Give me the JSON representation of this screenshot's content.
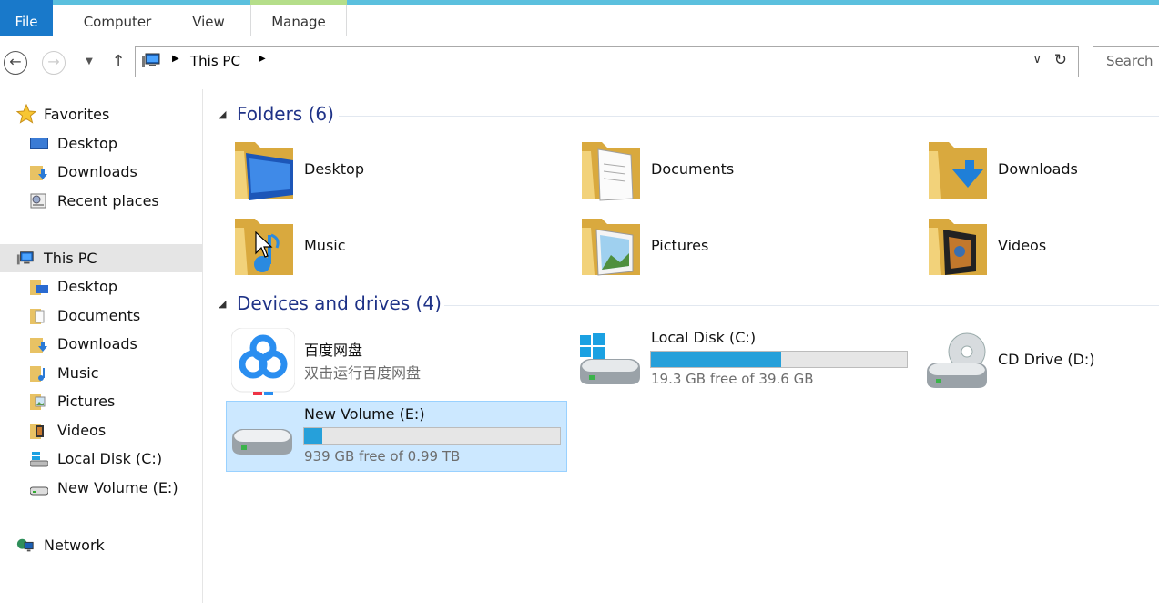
{
  "ribbon": {
    "tabs": {
      "file": "File",
      "computer": "Computer",
      "view": "View",
      "manage": "Manage"
    }
  },
  "address_bar": {
    "path": "This PC",
    "search_placeholder": "Search"
  },
  "nav_pane": {
    "favorites": "Favorites",
    "fav_desktop": "Desktop",
    "fav_downloads": "Downloads",
    "fav_recent": "Recent places",
    "this_pc": "This PC",
    "pc_desktop": "Desktop",
    "pc_documents": "Documents",
    "pc_downloads": "Downloads",
    "pc_music": "Music",
    "pc_pictures": "Pictures",
    "pc_videos": "Videos",
    "pc_local_disk": "Local Disk (C:)",
    "pc_new_volume": "New Volume (E:)",
    "network": "Network"
  },
  "folders": {
    "header": "Folders (6)",
    "desktop": "Desktop",
    "documents": "Documents",
    "downloads": "Downloads",
    "music": "Music",
    "pictures": "Pictures",
    "videos": "Videos"
  },
  "devices": {
    "header": "Devices and drives (4)",
    "baidu_name": "百度网盘",
    "baidu_sub": "双击运行百度网盘",
    "c_name": "Local Disk (C:)",
    "c_free": "19.3 GB free of 39.6 GB",
    "c_used_fraction": 0.51,
    "d_name": "CD Drive (D:)",
    "e_name": "New Volume (E:)",
    "e_free": "939 GB free of 0.99 TB",
    "e_used_fraction": 0.07
  },
  "colors": {
    "file_tab": "#1979ca",
    "ribbon_accent": "#5bc0de",
    "group_header": "#1e3287",
    "drive_bar_fill": "#26a0da",
    "selection": "#cce8ff"
  }
}
